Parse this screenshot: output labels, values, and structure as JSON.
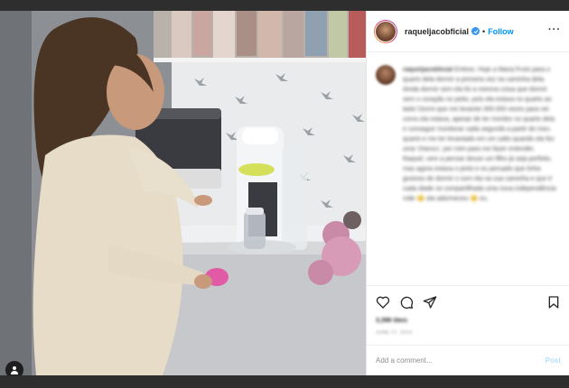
{
  "post": {
    "username": "raqueljacobficial",
    "follow_label": "Follow",
    "separator": "•",
    "more_label": "···"
  },
  "caption": {
    "username": "raqueljacobficial",
    "text": "Enfeoo. Hoje a Maria Fruto para o quarto dela dormir a primeira vez na caminha dela. Ainda dormir sem ela foi a mesma coisa que dormir sem o coração no peito, pois ela estava no quarto ao lado! Dormi que me levantei 300.000 vezes para ver como ela estava, apesar de ter monitor no quarto dela e conseguir monitorar cada segundo a partir do meu quarto e me ter levantado em um salto quando ela fez uma 'chanzu', por mim para me fazer entender. Raquel, vem a pensar desse um filho já seja perfeito, mas agora estava o pinto e eu peruado que tinha gostoso de dormir o som ela na sua caminha e que é cada idade se compartilhada uma nova independência mãe 😊 ela adormeceu 😊 eu."
  },
  "stats": {
    "likes": "3,396 likes",
    "date": "JUNE 17, 2019"
  },
  "comment": {
    "placeholder": "Add a comment...",
    "post_label": "Post"
  }
}
